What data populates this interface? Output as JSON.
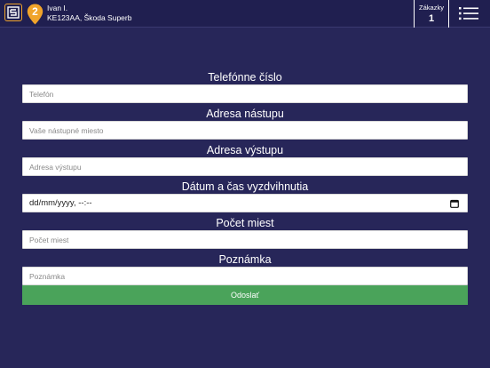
{
  "header": {
    "badge_number": "2",
    "driver_name": "Ivan I.",
    "vehicle": "KE123AA, Škoda Superb",
    "orders_label": "Zákazky",
    "orders_count": "1"
  },
  "form": {
    "phone_label": "Telefónne číslo",
    "phone_placeholder": "Telefón",
    "pickup_label": "Adresa nástupu",
    "pickup_placeholder": "Vaše nástupné miesto",
    "dropoff_label": "Adresa výstupu",
    "dropoff_placeholder": "Adresa výstupu",
    "datetime_label": "Dátum a čas vyzdvihnutia",
    "datetime_value": "dd/mm/yyyy, --:--",
    "seats_label": "Počet miest",
    "seats_placeholder": "Počet miest",
    "note_label": "Poznámka",
    "note_placeholder": "Poznámka",
    "submit_label": "Odoslať"
  },
  "colors": {
    "background": "#272659",
    "accent": "#f0a42b",
    "submit": "#4aa35a"
  },
  "icons": {
    "app": "app-logo-icon",
    "badge": "location-pin-icon",
    "menu": "list-menu-icon",
    "calendar": "calendar-icon"
  }
}
